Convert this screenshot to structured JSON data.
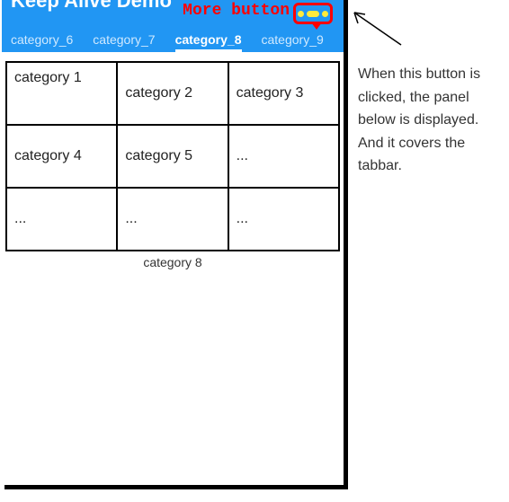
{
  "header": {
    "title": "Keep Alive Demo",
    "more_label": "More button"
  },
  "tabs": {
    "items": [
      {
        "label": "category_6",
        "active": false
      },
      {
        "label": "category_7",
        "active": false
      },
      {
        "label": "category_8",
        "active": true
      },
      {
        "label": "category_9",
        "active": false
      }
    ]
  },
  "grid": {
    "rows": [
      [
        "category 1",
        "category 2",
        "category 3"
      ],
      [
        "category 4",
        "category 5",
        "..."
      ],
      [
        "...",
        "...",
        "..."
      ]
    ],
    "footer": "category 8"
  },
  "annotation": {
    "text": "When this button is clicked, the panel below is displayed. And it covers the tabbar."
  }
}
